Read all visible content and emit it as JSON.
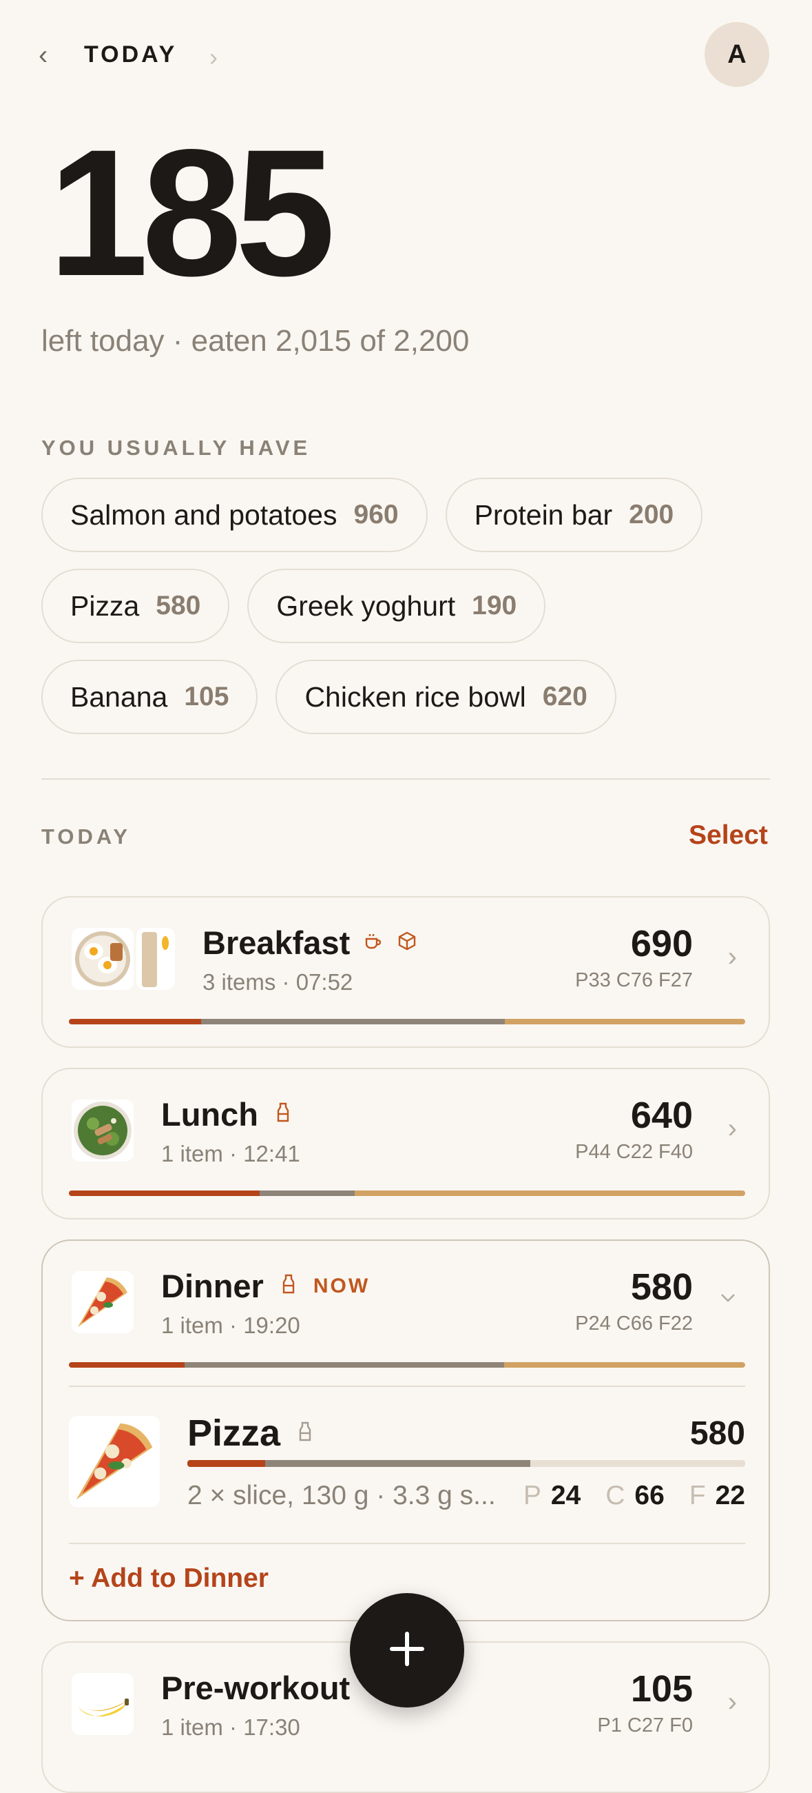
{
  "header": {
    "title": "TODAY",
    "prev_icon": "‹",
    "next_icon": "›",
    "avatar_initial": "A"
  },
  "summary": {
    "remaining": "185",
    "subtitle": "left today · eaten 2,015 of 2,200"
  },
  "usual": {
    "label": "YOU USUALLY HAVE",
    "chips": [
      {
        "name": "Salmon and potatoes",
        "cal": "960"
      },
      {
        "name": "Protein bar",
        "cal": "200"
      },
      {
        "name": "Pizza",
        "cal": "580"
      },
      {
        "name": "Greek yoghurt",
        "cal": "190"
      },
      {
        "name": "Banana",
        "cal": "105"
      },
      {
        "name": "Chicken rice bowl",
        "cal": "620"
      }
    ]
  },
  "today": {
    "label": "TODAY",
    "select_label": "Select"
  },
  "colors": {
    "protein": "#b5441a",
    "carbs": "#8f8478",
    "fat": "#d1a263",
    "accent": "#b5441a"
  },
  "meals": [
    {
      "name": "Breakfast",
      "sub": "3 items · 07:52",
      "cal": "690",
      "macros": "P33 C76 F27",
      "icons": [
        "coffee-icon",
        "box-icon"
      ],
      "macro_split": {
        "protein": 0.196,
        "carbs": 0.449,
        "fat": 0.355
      }
    },
    {
      "name": "Lunch",
      "sub": "1 item · 12:41",
      "cal": "640",
      "macros": "P44 C22 F40",
      "icons": [
        "bottle-icon"
      ],
      "macro_split": {
        "protein": 0.282,
        "carbs": 0.141,
        "fat": 0.577
      }
    },
    {
      "name": "Dinner",
      "sub": "1 item · 19:20",
      "cal": "580",
      "macros": "P24 C66 F22",
      "badge": "NOW",
      "icons": [
        "bottle-icon"
      ],
      "macro_split": {
        "protein": 0.171,
        "carbs": 0.473,
        "fat": 0.356
      },
      "expanded": true,
      "items": [
        {
          "name": "Pizza",
          "cal": "580",
          "detail": "2 × slice, 130 g · 3.3 g s...",
          "p_label": "P",
          "p": "24",
          "c_label": "C",
          "c": "66",
          "f_label": "F",
          "f": "22",
          "macro_split": {
            "protein": 0.14,
            "carbs": 0.475,
            "fat": 0.385
          }
        }
      ],
      "add_label": "+ Add to Dinner"
    },
    {
      "name": "Pre-workout",
      "sub": "1 item · 17:30",
      "cal": "105",
      "macros": "P1 C27 F0",
      "icons": []
    }
  ],
  "fab": {
    "icon": "plus-icon"
  }
}
